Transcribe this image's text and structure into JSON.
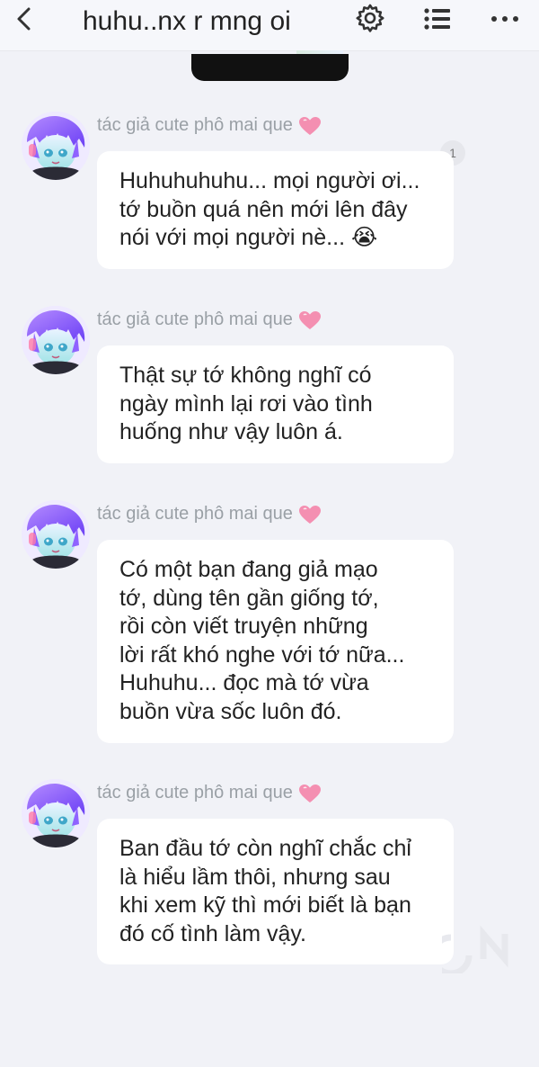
{
  "header": {
    "title": "huhu..nx r mng oi",
    "back_icon": "chevron-left-icon",
    "settings_icon": "gear-icon",
    "list_icon": "list-icon",
    "more_icon": "more-horizontal-icon"
  },
  "messages": [
    {
      "author": "tác giả cute phô mai que",
      "lines": [
        "Huhuhuhuhu... mọi người ơi...",
        "tớ buồn quá nên mới lên đây",
        "nói với mọi người nè... 😭"
      ],
      "reply_count": "1"
    },
    {
      "author": "tác giả cute phô mai que",
      "lines": [
        "Thật sự tớ không nghĩ có",
        "ngày mình lại rơi vào tình",
        "huống như vậy luôn á."
      ]
    },
    {
      "author": "tác giả cute phô mai que",
      "lines": [
        "Có một bạn đang giả mạo",
        "tớ, dùng tên gần giống tớ,",
        "rồi còn viết truyện những",
        "lời rất khó nghe với tớ nữa...",
        "Huhuhu... đọc mà tớ vừa",
        "buồn vừa sốc luôn đó."
      ]
    },
    {
      "author": "tác giả cute phô mai que",
      "lines": [
        "Ban đầu tớ còn nghĩ chắc chỉ",
        "là hiểu lầm thôi, nhưng sau",
        "khi xem kỹ thì mới biết là bạn",
        "đó cố tình làm vậy."
      ]
    }
  ],
  "colors": {
    "background": "#f1f2f7",
    "bubble": "#ffffff",
    "author_text": "#9aa0a6",
    "heart": "#f48fb1",
    "avatar_hair": "#8a63ff"
  }
}
